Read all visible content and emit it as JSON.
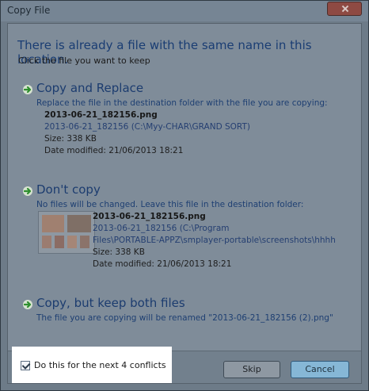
{
  "window": {
    "title": "Copy File"
  },
  "header": {
    "headline": "There is already a file with the same name in this location.",
    "subline": "Click the file you want to keep"
  },
  "options": {
    "copy_replace": {
      "title": "Copy and Replace",
      "desc": "Replace the file in the destination folder with the file you are copying:",
      "file": {
        "name": "2013-06-21_182156.png",
        "path": "2013-06-21_182156 (C:\\Myy-CHAR\\GRAND SORT)",
        "size": "Size: 338 KB",
        "modified": "Date modified: 21/06/2013 18:21"
      }
    },
    "dont_copy": {
      "title": "Don't copy",
      "desc": "No files will be changed. Leave this file in the destination folder:",
      "file": {
        "name": "2013-06-21_182156.png",
        "path_line1": "2013-06-21_182156 (C:\\Program",
        "path_line2": "Files\\PORTABLE-APPZ\\smplayer-portable\\screenshots\\hhhh",
        "size": "Size: 338 KB",
        "modified": "Date modified: 21/06/2013 18:21"
      }
    },
    "keep_both": {
      "title": "Copy, but keep both files",
      "desc": "The file you are copying will be renamed \"2013-06-21_182156 (2).png\""
    }
  },
  "footer": {
    "checkbox_label": "Do this for the next 4 conflicts",
    "checkbox_checked": true,
    "skip_label": "Skip",
    "cancel_label": "Cancel"
  },
  "icons": {
    "arrow": "green-arrow-icon",
    "close": "close-icon"
  }
}
